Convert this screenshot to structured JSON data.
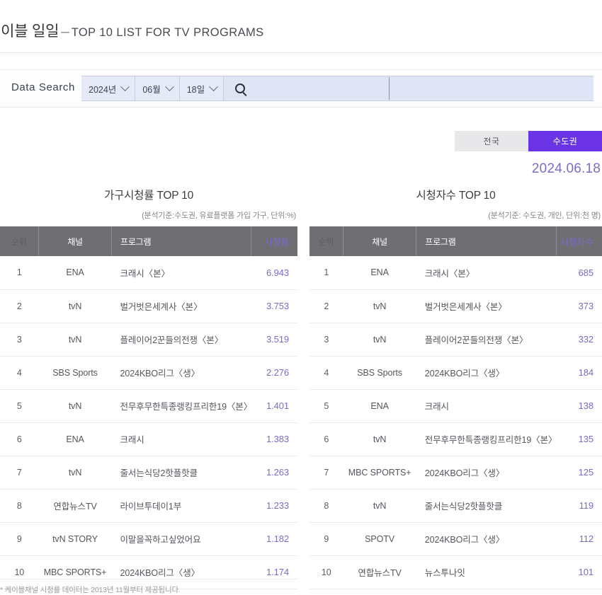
{
  "header": {
    "title_kr": "케이블 일일",
    "dash": "–",
    "title_en": "TOP 10 LIST FOR TV PROGRAMS"
  },
  "search": {
    "label": "Data Search",
    "year": "2024년",
    "month": "06월",
    "day": "18일",
    "search_icon": "search-icon"
  },
  "region": {
    "nationwide": "전국",
    "metro": "수도권",
    "selected": "수도권",
    "active_color": "#6a33e6",
    "inactive_color": "#e8e8ea"
  },
  "date_display": "2024.06.18",
  "footnote": "* 케이블채널 시청률 데이터는 2013년 11월부터 제공됩니다.",
  "tables": [
    {
      "title": "가구시청률 TOP 10",
      "subtitle": "(분석기준:수도권, 유료플랫폼 가입 가구, 단위:%)",
      "columns": [
        "순위",
        "채널",
        "프로그램",
        "시청률"
      ],
      "rows": [
        {
          "rank": "1",
          "channel": "ENA",
          "program": "크래시〈본〉",
          "value": "6.943"
        },
        {
          "rank": "2",
          "channel": "tvN",
          "program": "벌거벗은세계사〈본〉",
          "value": "3.753"
        },
        {
          "rank": "3",
          "channel": "tvN",
          "program": "플레이어2꾼들의전쟁〈본〉",
          "value": "3.519"
        },
        {
          "rank": "4",
          "channel": "SBS Sports",
          "program": "2024KBO리그〈생〉",
          "value": "2.276"
        },
        {
          "rank": "5",
          "channel": "tvN",
          "program": "전무후무한특종랭킹프리한19〈본〉",
          "value": "1.401"
        },
        {
          "rank": "6",
          "channel": "ENA",
          "program": "크래시",
          "value": "1.383"
        },
        {
          "rank": "7",
          "channel": "tvN",
          "program": "줄서는식당2핫플핫클",
          "value": "1.263"
        },
        {
          "rank": "8",
          "channel": "연합뉴스TV",
          "program": "라이브투데이1부",
          "value": "1.233"
        },
        {
          "rank": "9",
          "channel": "tvN STORY",
          "program": "이말을꼭하고싶었어요",
          "value": "1.182"
        },
        {
          "rank": "10",
          "channel": "MBC SPORTS+",
          "program": "2024KBO리그〈생〉",
          "value": "1.174"
        }
      ]
    },
    {
      "title": "시청자수 TOP 10",
      "subtitle": "(분석기준: 수도권, 개인, 단위:천 명)",
      "columns": [
        "순위",
        "채널",
        "프로그램",
        "시청자수"
      ],
      "rows": [
        {
          "rank": "1",
          "channel": "ENA",
          "program": "크래시〈본〉",
          "value": "685"
        },
        {
          "rank": "2",
          "channel": "tvN",
          "program": "벌거벗은세계사〈본〉",
          "value": "373"
        },
        {
          "rank": "3",
          "channel": "tvN",
          "program": "플레이어2꾼들의전쟁〈본〉",
          "value": "332"
        },
        {
          "rank": "4",
          "channel": "SBS Sports",
          "program": "2024KBO리그〈생〉",
          "value": "184"
        },
        {
          "rank": "5",
          "channel": "ENA",
          "program": "크래시",
          "value": "138"
        },
        {
          "rank": "6",
          "channel": "tvN",
          "program": "전무후무한특종랭킹프리한19〈본〉",
          "value": "135"
        },
        {
          "rank": "7",
          "channel": "MBC SPORTS+",
          "program": "2024KBO리그〈생〉",
          "value": "125"
        },
        {
          "rank": "8",
          "channel": "tvN",
          "program": "줄서는식당2핫플핫클",
          "value": "119"
        },
        {
          "rank": "9",
          "channel": "SPOTV",
          "program": "2024KBO리그〈생〉",
          "value": "112"
        },
        {
          "rank": "10",
          "channel": "연합뉴스TV",
          "program": "뉴스투나잇",
          "value": "101"
        }
      ]
    }
  ]
}
